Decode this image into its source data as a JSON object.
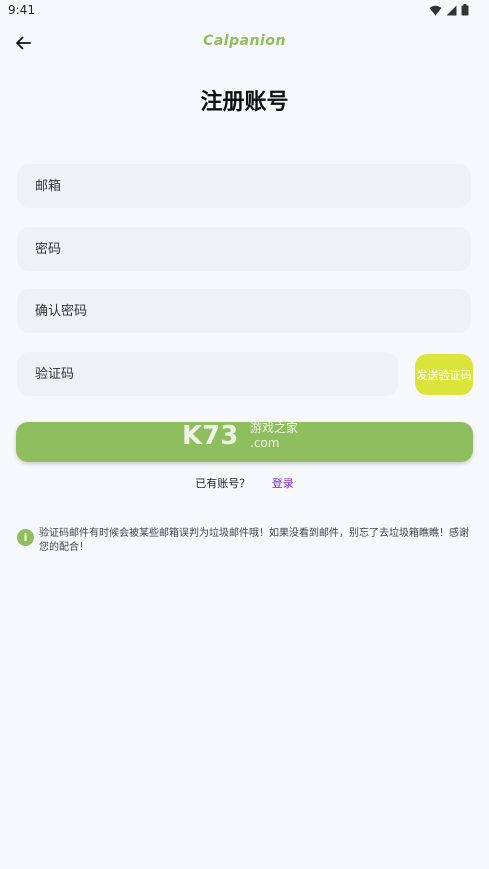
{
  "status_bar": {
    "time": "9:41",
    "icons": [
      "wifi-icon",
      "signal-icon",
      "battery-icon"
    ]
  },
  "app_bar": {
    "back_icon": "arrow-left-icon",
    "brand": "Calpanion"
  },
  "page": {
    "title": "注册账号"
  },
  "form": {
    "email_placeholder": "邮箱",
    "password_placeholder": "密码",
    "confirm_placeholder": "确认密码",
    "code_placeholder": "验证码",
    "send_code_label": "发送验证码",
    "register_label": ""
  },
  "login": {
    "prompt": "已有账号？",
    "link": "登录"
  },
  "notice": {
    "icon": "info-icon",
    "text": "验证码邮件有时候会被某些邮箱误判为垃圾邮件哦！如果没看到邮件，别忘了去垃圾箱瞧瞧！感谢您的配合！"
  },
  "watermark": {
    "logo": "K73",
    "line1": "游戏之家",
    "line2": ".com"
  },
  "colors": {
    "brand_green": "#8fbe5a",
    "register_button": "#8fbe5f",
    "send_code_button": "#dbe43a",
    "login_link": "#7b2bd6",
    "field_bg": "#eff1f5",
    "page_bg": "#f7f8fc"
  }
}
